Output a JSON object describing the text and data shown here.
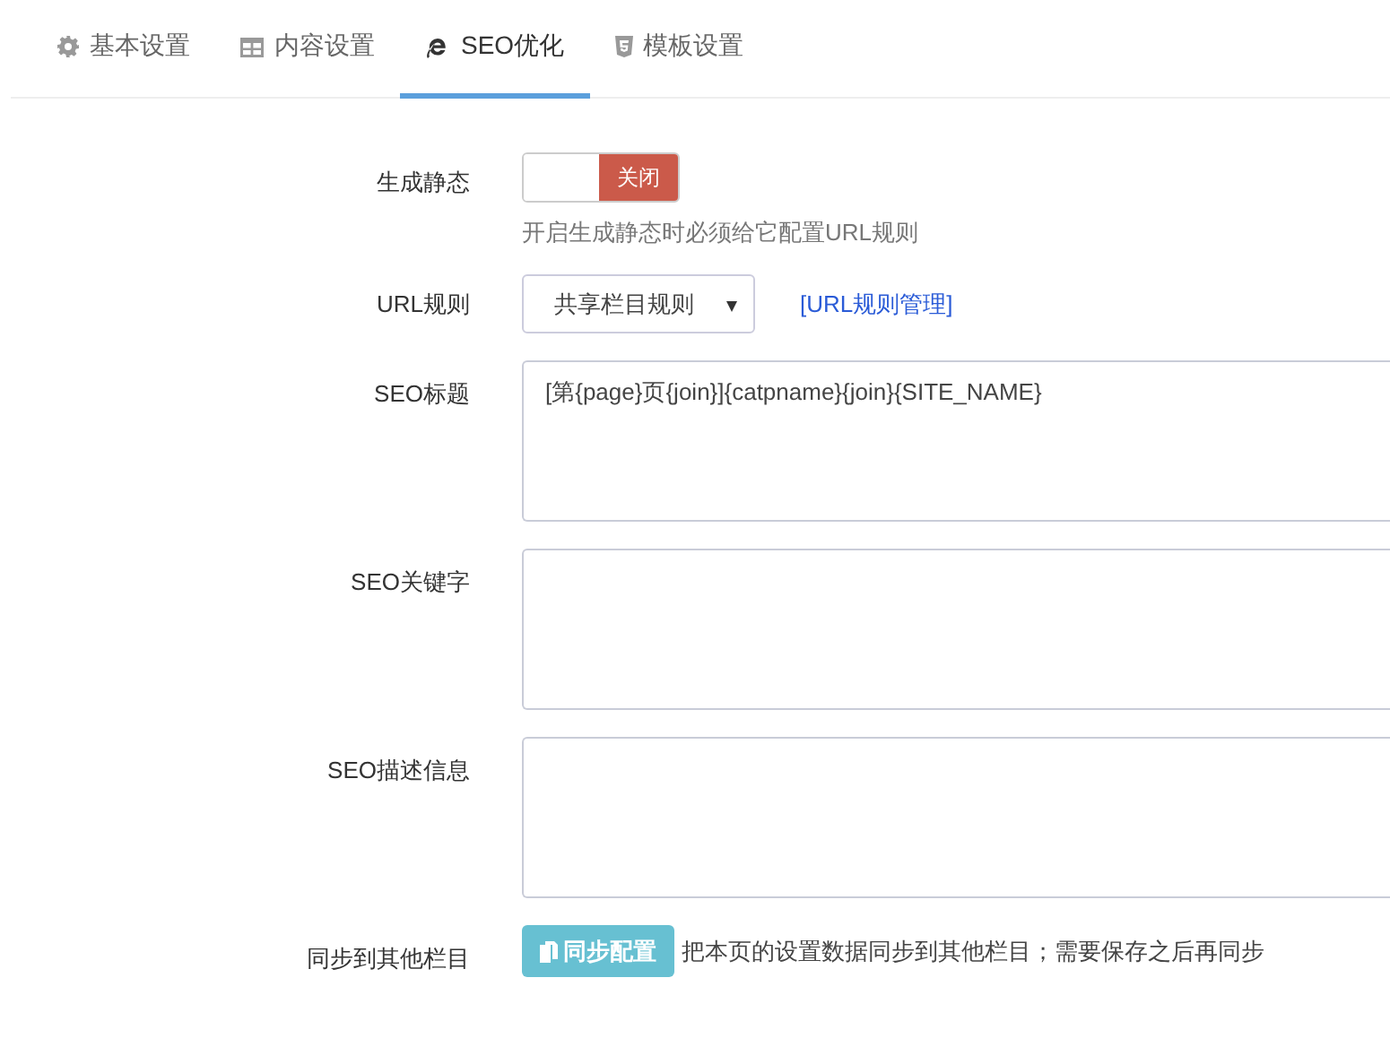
{
  "tabs": [
    {
      "label": "基本设置",
      "selected": false
    },
    {
      "label": "内容设置",
      "selected": false
    },
    {
      "label": "SEO优化",
      "selected": true
    },
    {
      "label": "模板设置",
      "selected": false
    }
  ],
  "fields": [
    {
      "kind": "toggle",
      "label": "生成静态",
      "on": false,
      "off_text": "关闭",
      "help": "开启生成静态时必须给它配置URL规则"
    },
    {
      "kind": "select",
      "label": "URL规则",
      "value": "共享栏目规则",
      "link": "[URL规则管理]"
    },
    {
      "kind": "textarea",
      "label": "SEO标题",
      "value": "[第{page}页{join}]{catpname}{join}{SITE_NAME}"
    },
    {
      "kind": "textarea",
      "label": "SEO关键字"
    },
    {
      "kind": "textarea",
      "label": "SEO描述信息"
    },
    {
      "kind": "button",
      "label": "同步到其他栏目",
      "button": "同步配置",
      "help": "把本页的设置数据同步到其他栏目；需要保存之后再同步"
    }
  ]
}
